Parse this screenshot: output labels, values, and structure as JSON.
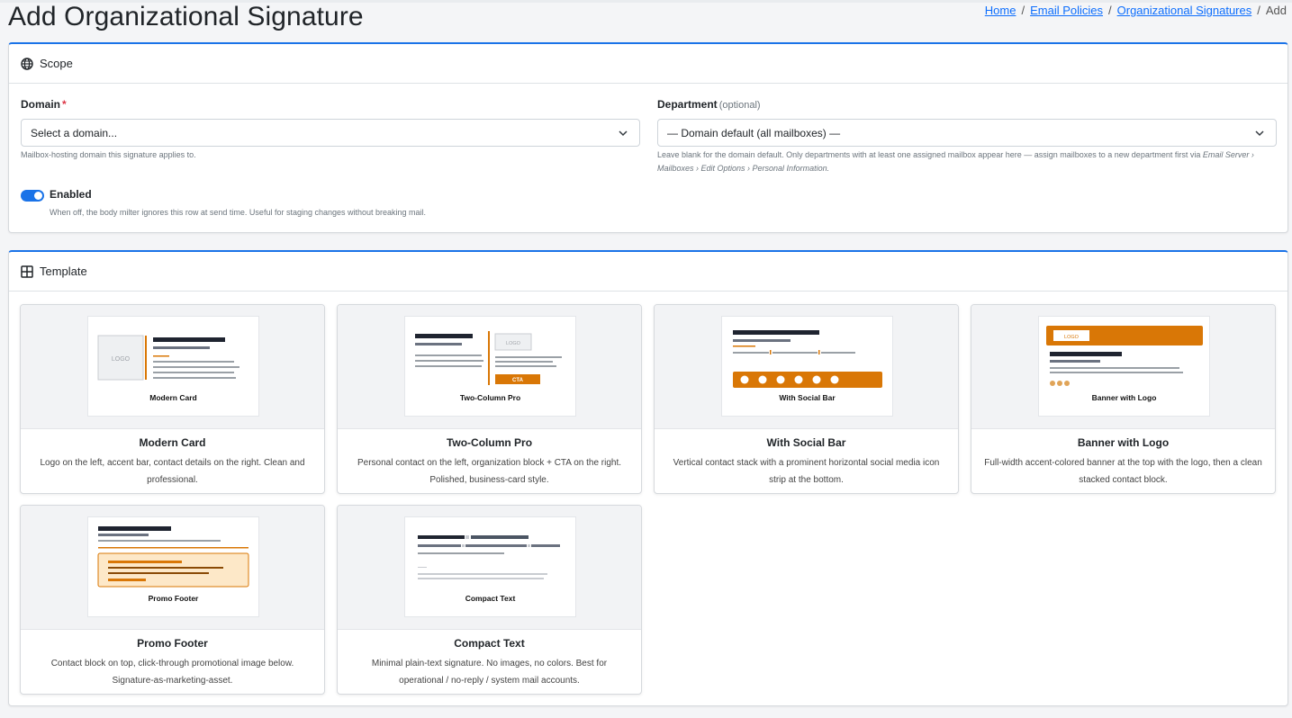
{
  "page": {
    "title": "Add Organizational Signature"
  },
  "breadcrumb": {
    "items": [
      "Home",
      "Email Policies",
      "Organizational Signatures"
    ],
    "current": "Add"
  },
  "scope": {
    "header": "Scope",
    "header_icon": "globe-icon",
    "domain": {
      "label": "Domain",
      "required_mark": "*",
      "value": "Select a domain...",
      "help": "Mailbox-hosting domain this signature applies to."
    },
    "department": {
      "label": "Department",
      "optional": "(optional)",
      "value": "— Domain default (all mailboxes) —",
      "help_prefix": "Leave blank for the domain default. Only departments with at least one assigned mailbox appear here — assign mailboxes to a new department first via ",
      "help_path_1": "Email Server ›",
      "help_path_2": "Mailboxes › Edit Options › Personal Information."
    },
    "enabled": {
      "label": "Enabled",
      "on": true,
      "help": "When off, the body milter ignores this row at send time. Useful for staging changes without breaking mail."
    }
  },
  "template": {
    "header": "Template",
    "header_icon": "table-icon",
    "accent": "#d97706",
    "cards": [
      {
        "id": "modern-card",
        "thumb_label": "Modern Card",
        "logo_text": "LOGO",
        "name": "Modern Card",
        "description": "Logo on the left, accent bar, contact details on the right. Clean and professional."
      },
      {
        "id": "two-column-pro",
        "thumb_label": "Two-Column Pro",
        "logo_text": "LOGO",
        "cta_text": "CTA",
        "name": "Two-Column Pro",
        "description": "Personal contact on the left, organization block + CTA on the right. Polished, business-card style."
      },
      {
        "id": "with-social-bar",
        "thumb_label": "With Social Bar",
        "name": "With Social Bar",
        "description": "Vertical contact stack with a prominent horizontal social media icon strip at the bottom."
      },
      {
        "id": "banner-with-logo",
        "thumb_label": "Banner with Logo",
        "logo_text": "LOGO",
        "name": "Banner with Logo",
        "description": "Full-width accent-colored banner at the top with the logo, then a clean stacked contact block."
      },
      {
        "id": "promo-footer",
        "thumb_label": "Promo Footer",
        "name": "Promo Footer",
        "description": "Contact block on top, click-through promotional image below. Signature-as-marketing-asset."
      },
      {
        "id": "compact-text",
        "thumb_label": "Compact Text",
        "name": "Compact Text",
        "description": "Minimal plain-text signature. No images, no colors. Best for operational / no-reply / system mail accounts."
      }
    ]
  }
}
